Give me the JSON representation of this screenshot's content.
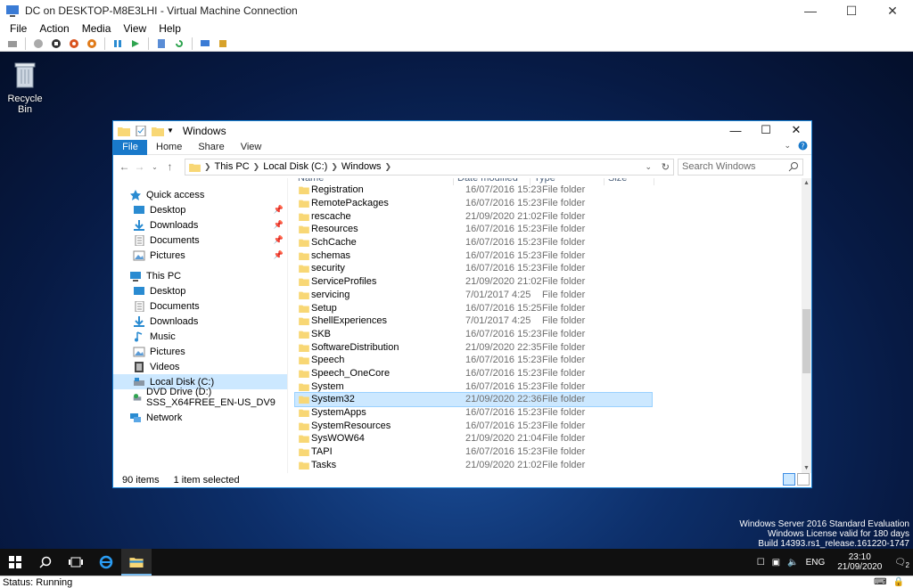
{
  "host": {
    "title": "DC on DESKTOP-M8E3LHI - Virtual Machine Connection",
    "menu": [
      "File",
      "Action",
      "Media",
      "View",
      "Help"
    ],
    "status": "Status: Running"
  },
  "desktop": {
    "recycle_label": "Recycle Bin",
    "watermark": {
      "line1": "Windows Server 2016 Standard Evaluation",
      "line2": "Windows License valid for 180 days",
      "line3": "Build 14393.rs1_release.161220-1747"
    }
  },
  "explorer": {
    "title": "Windows",
    "ribbon": {
      "file": "File",
      "home": "Home",
      "share": "Share",
      "view": "View"
    },
    "address": {
      "this_pc": "This PC",
      "local_disk": "Local Disk (C:)",
      "windows": "Windows"
    },
    "search_placeholder": "Search Windows",
    "nav": {
      "quick_access": "Quick access",
      "desktop": "Desktop",
      "downloads": "Downloads",
      "documents": "Documents",
      "pictures": "Pictures",
      "this_pc": "This PC",
      "pc_desktop": "Desktop",
      "pc_documents": "Documents",
      "pc_downloads": "Downloads",
      "music": "Music",
      "pc_pictures": "Pictures",
      "videos": "Videos",
      "local_disk": "Local Disk (C:)",
      "dvd": "DVD Drive (D:) SSS_X64FREE_EN-US_DV9",
      "network": "Network"
    },
    "columns": {
      "name": "Name",
      "date": "Date modified",
      "type": "Type",
      "size": "Size"
    },
    "rows": [
      {
        "name": "Registration",
        "date": "16/07/2016 15:23",
        "type": "File folder"
      },
      {
        "name": "RemotePackages",
        "date": "16/07/2016 15:23",
        "type": "File folder"
      },
      {
        "name": "rescache",
        "date": "21/09/2020 21:02",
        "type": "File folder"
      },
      {
        "name": "Resources",
        "date": "16/07/2016 15:23",
        "type": "File folder"
      },
      {
        "name": "SchCache",
        "date": "16/07/2016 15:23",
        "type": "File folder"
      },
      {
        "name": "schemas",
        "date": "16/07/2016 15:23",
        "type": "File folder"
      },
      {
        "name": "security",
        "date": "16/07/2016 15:23",
        "type": "File folder"
      },
      {
        "name": "ServiceProfiles",
        "date": "21/09/2020 21:02",
        "type": "File folder"
      },
      {
        "name": "servicing",
        "date": "7/01/2017 4:25",
        "type": "File folder"
      },
      {
        "name": "Setup",
        "date": "16/07/2016 15:25",
        "type": "File folder"
      },
      {
        "name": "ShellExperiences",
        "date": "7/01/2017 4:25",
        "type": "File folder"
      },
      {
        "name": "SKB",
        "date": "16/07/2016 15:23",
        "type": "File folder"
      },
      {
        "name": "SoftwareDistribution",
        "date": "21/09/2020 22:35",
        "type": "File folder"
      },
      {
        "name": "Speech",
        "date": "16/07/2016 15:23",
        "type": "File folder"
      },
      {
        "name": "Speech_OneCore",
        "date": "16/07/2016 15:23",
        "type": "File folder"
      },
      {
        "name": "System",
        "date": "16/07/2016 15:23",
        "type": "File folder"
      },
      {
        "name": "System32",
        "date": "21/09/2020 22:36",
        "type": "File folder"
      },
      {
        "name": "SystemApps",
        "date": "16/07/2016 15:23",
        "type": "File folder"
      },
      {
        "name": "SystemResources",
        "date": "16/07/2016 15:23",
        "type": "File folder"
      },
      {
        "name": "SysWOW64",
        "date": "21/09/2020 21:04",
        "type": "File folder"
      },
      {
        "name": "TAPI",
        "date": "16/07/2016 15:23",
        "type": "File folder"
      },
      {
        "name": "Tasks",
        "date": "21/09/2020 21:02",
        "type": "File folder"
      }
    ],
    "status": {
      "count": "90 items",
      "selected": "1 item selected"
    }
  },
  "taskbar": {
    "lang": "ENG",
    "time": "23:10",
    "date": "21/09/2020",
    "notif_count": "2"
  },
  "colors": {
    "accent": "#1979ca",
    "selection": "#cce8ff",
    "folder": "#f8d775"
  }
}
